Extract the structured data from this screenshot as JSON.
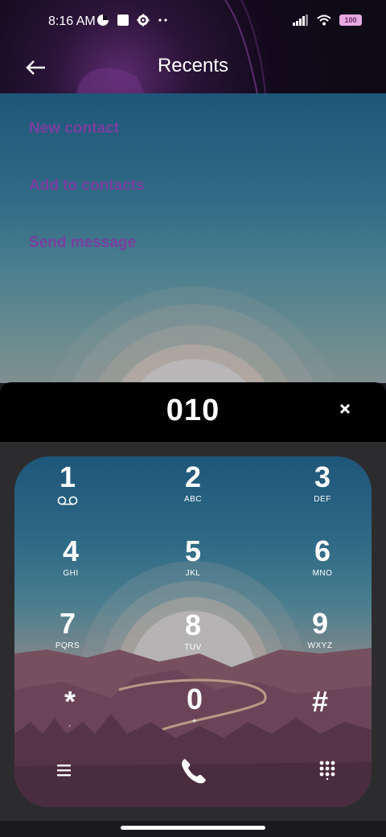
{
  "status_bar": {
    "time": "8:16 AM",
    "battery": "100"
  },
  "header": {
    "title": "Recents"
  },
  "options": [
    "New contact",
    "Add to contacts",
    "Send message"
  ],
  "dialer": {
    "number": "010"
  },
  "keys": [
    {
      "digit": "1",
      "letters": ""
    },
    {
      "digit": "2",
      "letters": "ABC"
    },
    {
      "digit": "3",
      "letters": "DEF"
    },
    {
      "digit": "4",
      "letters": "GHI"
    },
    {
      "digit": "5",
      "letters": "JKL"
    },
    {
      "digit": "6",
      "letters": "MNO"
    },
    {
      "digit": "7",
      "letters": "PQRS"
    },
    {
      "digit": "8",
      "letters": "TUV"
    },
    {
      "digit": "9",
      "letters": "WXYZ"
    },
    {
      "digit": "*",
      "letters": ","
    },
    {
      "digit": "0",
      "letters": "+"
    },
    {
      "digit": "#",
      "letters": ""
    }
  ],
  "icons": [
    "back-arrow-icon",
    "clear-icon",
    "voicemail-icon",
    "menu-icon",
    "phone-icon",
    "dialpad-icon"
  ],
  "colors": {
    "option_text": "#7b3ea0",
    "number_bar": "#000000"
  }
}
